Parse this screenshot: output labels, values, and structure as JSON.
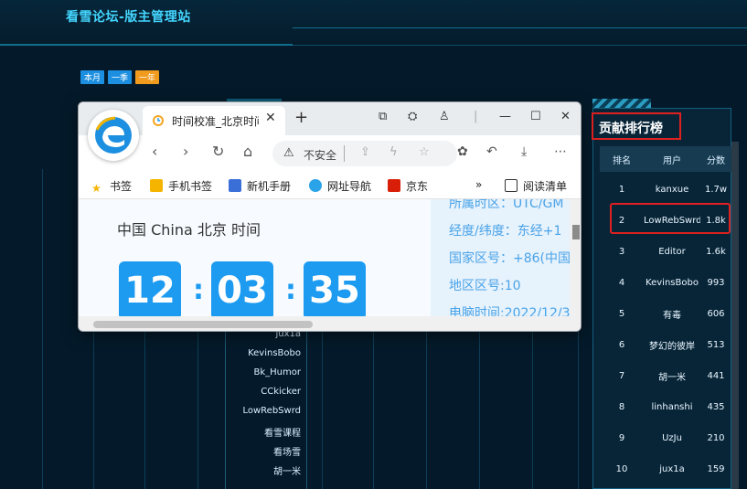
{
  "dashboard": {
    "title": "看雪论坛-版主管理站",
    "period_tabs": [
      "本月",
      "一季",
      "一年"
    ],
    "middle_list": [
      "jux1a",
      "KevinsBobo",
      "Bk_Humor",
      "CCkicker",
      "LowRebSwrd",
      "看雪课程",
      "看场雪",
      "胡一米"
    ]
  },
  "ranking": {
    "title": "贡献排行榜",
    "headers": [
      "排名",
      "用户",
      "分数"
    ],
    "rows": [
      {
        "rank": "1",
        "user": "kanxue",
        "score": "1.7w"
      },
      {
        "rank": "2",
        "user": "LowRebSwrd",
        "score": "1.8k"
      },
      {
        "rank": "3",
        "user": "Editor",
        "score": "1.6k"
      },
      {
        "rank": "4",
        "user": "KevinsBobo",
        "score": "993"
      },
      {
        "rank": "5",
        "user": "有毒",
        "score": "606"
      },
      {
        "rank": "6",
        "user": "梦幻的彼岸",
        "score": "513"
      },
      {
        "rank": "7",
        "user": "胡一米",
        "score": "441"
      },
      {
        "rank": "8",
        "user": "linhanshi",
        "score": "435"
      },
      {
        "rank": "9",
        "user": "UzJu",
        "score": "210"
      },
      {
        "rank": "10",
        "user": "jux1a",
        "score": "159"
      }
    ]
  },
  "browser": {
    "tab_title": "时间校准_北京时间",
    "address_warning": "不安全",
    "bookmarks": [
      "书签",
      "手机书签",
      "新机手册",
      "网址导航",
      "京东"
    ],
    "more_bookmarks": "»",
    "reading_list": "阅读清单",
    "page": {
      "heading": "中国 China 北京 时间",
      "hours": "12",
      "minutes": "03",
      "seconds": "35",
      "info": [
        "所属时区：UTC/GM",
        "经度/纬度：东经+1",
        "国家区号：+86(中国",
        "地区区号:10",
        "电脑时间:2022/12/3"
      ]
    }
  },
  "colors": {
    "accent": "#44d6ff",
    "highlight_box": "#e02020",
    "digit_bg": "#1d9bf0"
  },
  "icons": [
    "edge-logo-icon",
    "clock-icon",
    "close-icon",
    "plus-icon",
    "minimize-icon",
    "maximize-icon",
    "back-icon",
    "forward-icon",
    "refresh-icon",
    "home-icon",
    "warning-icon",
    "star-icon",
    "extensions-icon",
    "download-icon",
    "more-icon"
  ]
}
